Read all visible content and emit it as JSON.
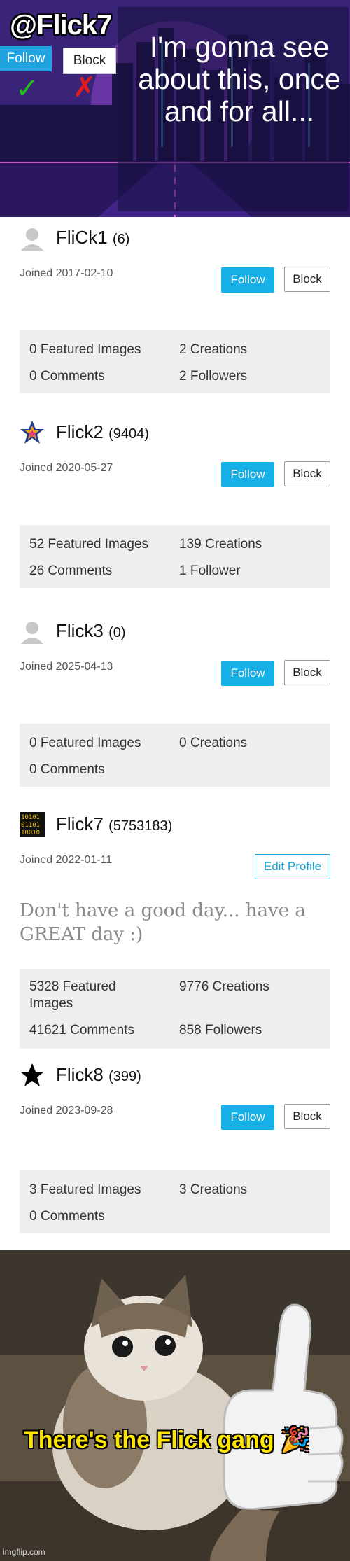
{
  "banner": {
    "username": "@Flick7",
    "follow_label": "Follow",
    "block_label": "Block",
    "check_glyph": "✓",
    "cross_glyph": "✗",
    "quote": "I'm gonna see about this, once and for all..."
  },
  "profiles": [
    {
      "name": "FliCk1",
      "score": "(6)",
      "avatar": "default-avatar",
      "joined": "Joined 2017-02-10",
      "follow_label": "Follow",
      "block_label": "Block",
      "stats": {
        "featured": "0 Featured Images",
        "creations": "2 Creations",
        "comments": "0 Comments",
        "followers": "2 Followers"
      }
    },
    {
      "name": "Flick2",
      "score": "(9404)",
      "avatar": "star-colorful-avatar",
      "joined": "Joined 2020-05-27",
      "follow_label": "Follow",
      "block_label": "Block",
      "stats": {
        "featured": "52 Featured Images",
        "creations": "139 Creations",
        "comments": "26 Comments",
        "followers": "1 Follower"
      }
    },
    {
      "name": "Flick3",
      "score": "(0)",
      "avatar": "default-avatar",
      "joined": "Joined 2025-04-13",
      "follow_label": "Follow",
      "block_label": "Block",
      "stats": {
        "featured": "0 Featured Images",
        "creations": "0 Creations",
        "comments": "0 Comments"
      }
    },
    {
      "name": "Flick7",
      "score": "(5753183)",
      "avatar": "binary-avatar",
      "joined": "Joined 2022-01-11",
      "edit_label": "Edit Profile",
      "bio": "Don't have a good day... have a GREAT day :)",
      "stats": {
        "featured": "5328 Featured Images",
        "creations": "9776 Creations",
        "comments": "41621 Comments",
        "followers": "858 Followers"
      }
    },
    {
      "name": "Flick8",
      "score": "(399)",
      "avatar": "black-star-avatar",
      "joined": "Joined 2023-09-28",
      "follow_label": "Follow",
      "block_label": "Block",
      "stats": {
        "featured": "3 Featured Images",
        "creations": "3 Creations",
        "comments": "0 Comments"
      }
    }
  ],
  "meme": {
    "caption": "There's the Flick gang 🎉",
    "watermark": "imgflip.com"
  },
  "colors": {
    "follow": "#16b0e6",
    "banner_purple": "#5b2fa8",
    "caption_yellow": "#ffe600",
    "stats_bg": "#efefef"
  }
}
